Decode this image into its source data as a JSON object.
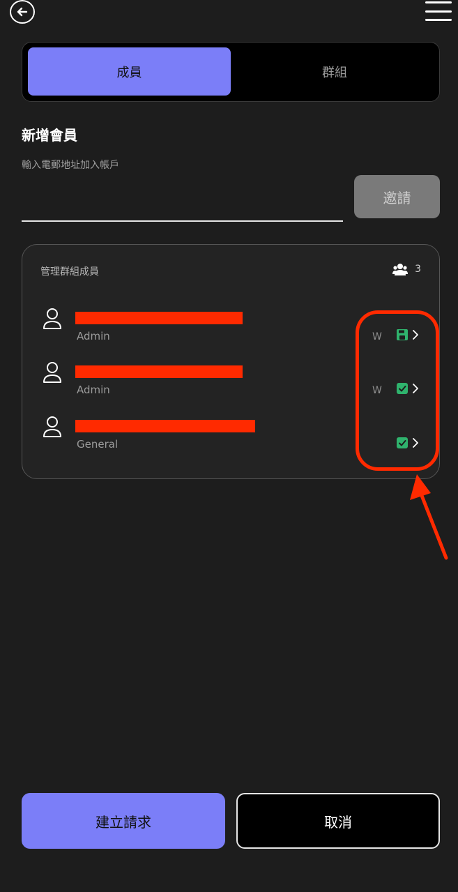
{
  "tabs": {
    "members": "成員",
    "groups": "群組"
  },
  "add_member": {
    "title": "新增會員",
    "hint": "輸入電郵地址加入帳戶",
    "email_value": "",
    "invite_label": "邀請"
  },
  "group_card": {
    "title": "管理群組成員",
    "count": "3",
    "members": [
      {
        "role": "Admin",
        "permission": "W",
        "status_icon": "save-icon"
      },
      {
        "role": "Admin",
        "permission": "W",
        "status_icon": "check-icon"
      },
      {
        "role": "General",
        "permission": "",
        "status_icon": "check-icon"
      }
    ]
  },
  "footer": {
    "create_label": "建立請求",
    "cancel_label": "取消"
  },
  "colors": {
    "accent": "#7b7ef8",
    "success": "#2fb36d",
    "highlight": "#ff2a00",
    "background": "#1d1d1d"
  }
}
